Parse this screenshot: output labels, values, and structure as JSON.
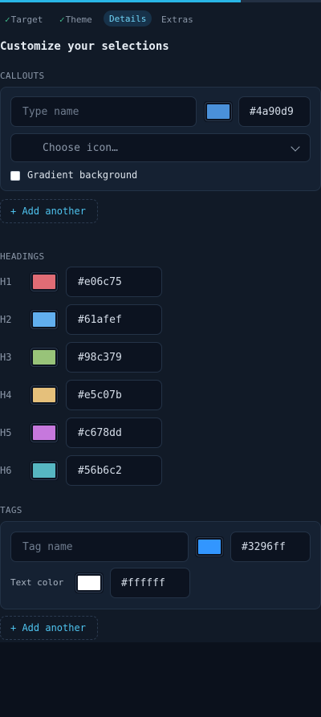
{
  "progress": {
    "fraction": 0.75
  },
  "tabs": [
    {
      "label": "Target",
      "done": true
    },
    {
      "label": "Theme",
      "done": true
    },
    {
      "label": "Details",
      "active": true
    },
    {
      "label": "Extras"
    }
  ],
  "check_glyph": "✓",
  "title": "Customize your selections",
  "callouts": {
    "label": "CALLOUTS",
    "name_placeholder": "Type name",
    "color": "#4a90d9",
    "icon_placeholder": "Choose icon…",
    "gradient_label": "Gradient background",
    "add_label": "+ Add another"
  },
  "headings": {
    "label": "HEADINGS",
    "items": [
      {
        "label": "H1",
        "color": "#e06c75"
      },
      {
        "label": "H2",
        "color": "#61afef"
      },
      {
        "label": "H3",
        "color": "#98c379"
      },
      {
        "label": "H4",
        "color": "#e5c07b"
      },
      {
        "label": "H5",
        "color": "#c678dd"
      },
      {
        "label": "H6",
        "color": "#56b6c2"
      }
    ]
  },
  "tags": {
    "label": "TAGS",
    "name_placeholder": "Tag name",
    "color": "#3296ff",
    "text_color_label": "Text color",
    "text_color": "#ffffff",
    "add_label": "+ Add another"
  }
}
